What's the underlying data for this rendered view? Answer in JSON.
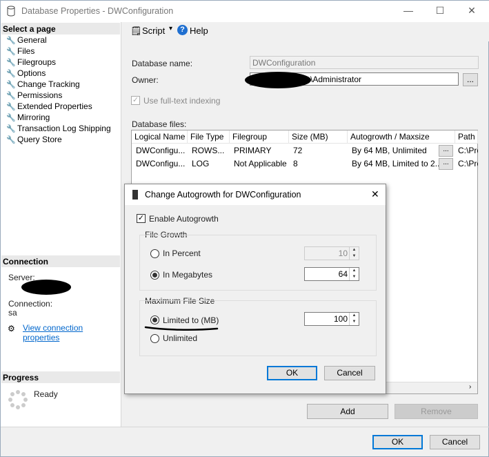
{
  "window": {
    "title": "Database Properties - DWConfiguration",
    "minimize": "—",
    "maximize": "☐",
    "close": "✕"
  },
  "sidebar": {
    "select_page_header": "Select a page",
    "items": [
      {
        "label": "General"
      },
      {
        "label": "Files"
      },
      {
        "label": "Filegroups"
      },
      {
        "label": "Options"
      },
      {
        "label": "Change Tracking"
      },
      {
        "label": "Permissions"
      },
      {
        "label": "Extended Properties"
      },
      {
        "label": "Mirroring"
      },
      {
        "label": "Transaction Log Shipping"
      },
      {
        "label": "Query Store"
      }
    ],
    "connection_header": "Connection",
    "server_label": "Server:",
    "connection_label": "Connection:",
    "connection_value": "sa",
    "view_connection_link": "View connection properties",
    "progress_header": "Progress",
    "progress_status": "Ready"
  },
  "toolbar": {
    "script_label": "Script",
    "help_label": "Help"
  },
  "form": {
    "database_name_label": "Database name:",
    "database_name_value": "DWConfiguration",
    "owner_label": "Owner:",
    "owner_value": "\\Administrator",
    "browse_label": "...",
    "fulltext_label": "Use full-text indexing",
    "database_files_label": "Database files:"
  },
  "grid": {
    "columns": [
      "Logical Name",
      "File Type",
      "Filegroup",
      "Size (MB)",
      "Autogrowth / Maxsize",
      "Path"
    ],
    "rows": [
      [
        "DWConfigu...",
        "ROWS...",
        "PRIMARY",
        "72",
        "By 64 MB, Unlimited",
        "...",
        "C:\\Pro"
      ],
      [
        "DWConfigu...",
        "LOG",
        "Not Applicable",
        "8",
        "By 64 MB, Limited to 2...",
        "...",
        "C:\\Pro"
      ]
    ]
  },
  "bottom": {
    "add_label": "Add",
    "remove_label": "Remove",
    "ok_label": "OK",
    "cancel_label": "Cancel"
  },
  "dialog": {
    "title": "Change Autogrowth for DWConfiguration",
    "close": "✕",
    "enable_autogrowth_label": "Enable Autogrowth",
    "file_growth_label": "File Growth",
    "in_percent_label": "In Percent",
    "in_percent_value": "10",
    "in_megabytes_label": "In Megabytes",
    "in_megabytes_value": "64",
    "max_file_size_label": "Maximum File Size",
    "limited_label": "Limited to (MB)",
    "limited_value": "100",
    "unlimited_label": "Unlimited",
    "ok_label": "OK",
    "cancel_label": "Cancel"
  }
}
